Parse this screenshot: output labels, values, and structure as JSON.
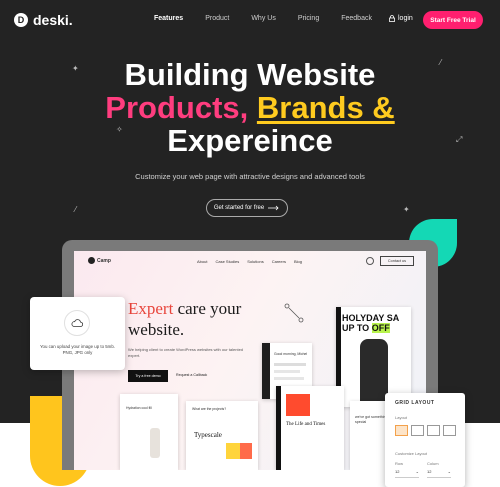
{
  "brand": {
    "logo_glyph": "D",
    "name": "deski."
  },
  "nav": {
    "links": [
      "Features",
      "Product",
      "Why Us",
      "Pricing",
      "Feedback"
    ],
    "active": "Features",
    "login": "login",
    "cta": "Start Free Trial"
  },
  "hero": {
    "line1": "Building Website",
    "line2_pink": "Products,",
    "line2_yellow": "Brands &",
    "line3": "Expereince",
    "subtitle": "Customize your web page with attractive designs and advanced tools",
    "button": "Get started for free"
  },
  "mockup": {
    "logo": "Camp",
    "links": [
      "About",
      "Case Studies",
      "Solutions",
      "Careers",
      "Blog"
    ],
    "contact": "Contact us",
    "heading_accent": "Expert",
    "heading_rest": " care your",
    "heading_line2": "website.",
    "desc": "We helping client to create WordPress websites with our talented expert.",
    "btn_primary": "Try a free demo",
    "btn_secondary": "Request a Callback",
    "card1_title": "Good morning, Michel",
    "poster_text1": "HOLYDAY",
    "poster_text2": "UP TO",
    "poster_text3": "SA",
    "poster_text4": "OFF",
    "card_search": "What are the projects?",
    "card_typo": "Typescale",
    "card_product": "Hydration cool fill",
    "card_life": "The Life and Times",
    "card_special": "we've got something special"
  },
  "upload": {
    "text": "You can upload your image up to 5mb. PNG, JPG only"
  },
  "grid_panel": {
    "title": "GRID LAYOUT",
    "layout_label": "Layout",
    "customize_label": "Customize Layout",
    "row_label": "Row",
    "column_label": "Colum",
    "row_value": "12",
    "column_value": "12"
  },
  "colors": {
    "background": "#232323",
    "pink": "#ff3d7f",
    "cta": "#ff1f6f",
    "yellow": "#ffcb1f",
    "teal": "#14d8b5"
  }
}
